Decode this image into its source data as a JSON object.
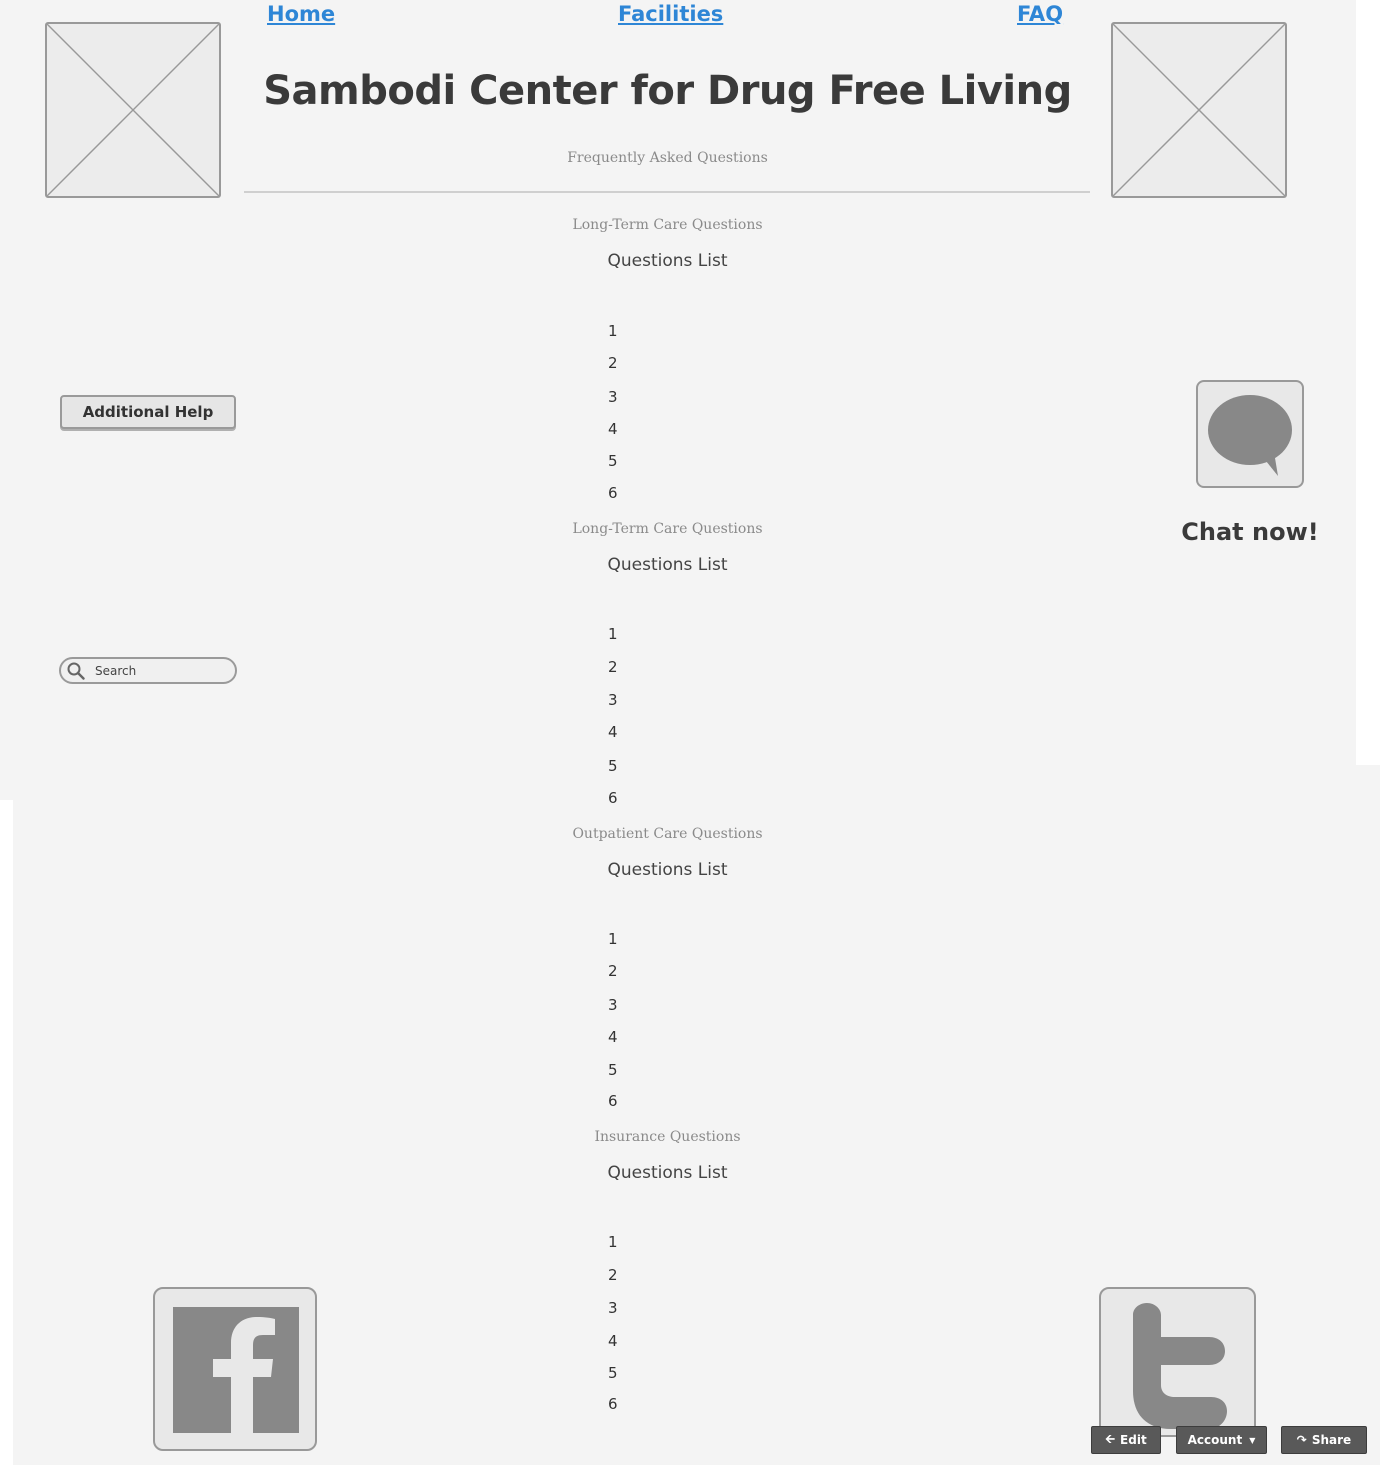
{
  "nav": {
    "home": "Home",
    "facilities": "Facilities",
    "faq": "FAQ"
  },
  "header": {
    "title": "Sambodi Center for Drug Free Living",
    "subtitle": "Frequently Asked Questions"
  },
  "sidebar": {
    "help_button": "Additional Help",
    "search_placeholder": "Search"
  },
  "chat": {
    "label": "Chat now!"
  },
  "sections": [
    {
      "heading": "Long-Term Care Questions",
      "list_label": "Questions List",
      "items": [
        "1",
        "2",
        "3",
        "4",
        "5",
        "6"
      ]
    },
    {
      "heading": "Long-Term Care Questions",
      "list_label": "Questions List",
      "items": [
        "1",
        "2",
        "3",
        "4",
        "5",
        "6"
      ]
    },
    {
      "heading": "Outpatient Care Questions",
      "list_label": "Questions List",
      "items": [
        "1",
        "2",
        "3",
        "4",
        "5",
        "6"
      ]
    },
    {
      "heading": "Insurance Questions",
      "list_label": "Questions List",
      "items": [
        "1",
        "2",
        "3",
        "4",
        "5",
        "6"
      ]
    }
  ],
  "toolbar": {
    "edit": "Edit",
    "account": "Account",
    "share": "Share"
  },
  "colors": {
    "link": "#2e86d6",
    "background": "#f4f4f4",
    "toolbar": "#595959"
  },
  "icons": [
    "image-placeholder-icon",
    "search-icon",
    "speech-bubble-icon",
    "facebook-icon",
    "twitter-icon",
    "arrow-left-icon",
    "caret-down-icon",
    "share-icon"
  ]
}
